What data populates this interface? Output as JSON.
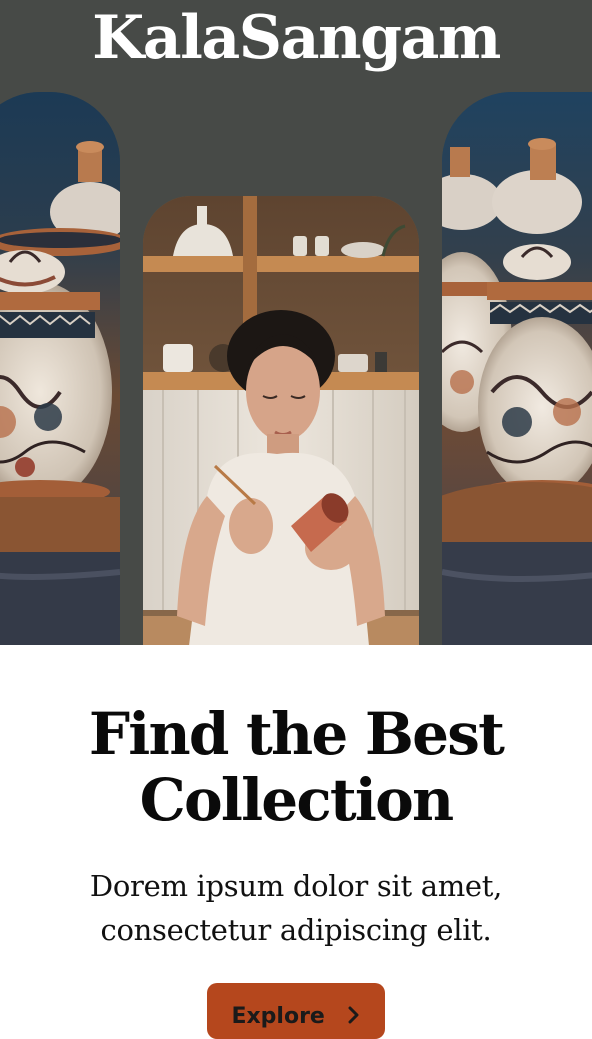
{
  "brand": {
    "name": "KalaSangam"
  },
  "hero": {
    "images": [
      {
        "name": "painted-pottery-jars-left",
        "semantic": "photo"
      },
      {
        "name": "artisan-painting-pottery",
        "semantic": "photo"
      },
      {
        "name": "painted-pottery-jars-right",
        "semantic": "photo"
      }
    ]
  },
  "main": {
    "headline_line1": "Find the Best",
    "headline_line2": "Collection",
    "subtitle_line1": "Dorem ipsum dolor sit amet,",
    "subtitle_line2": "consectetur adipiscing elit.",
    "cta_label": "Explore",
    "cta_icon": "chevron-right-icon"
  },
  "colors": {
    "hero_background": "#474a47",
    "cta_background": "#b5471d",
    "headline_text": "#0a0a0a"
  }
}
